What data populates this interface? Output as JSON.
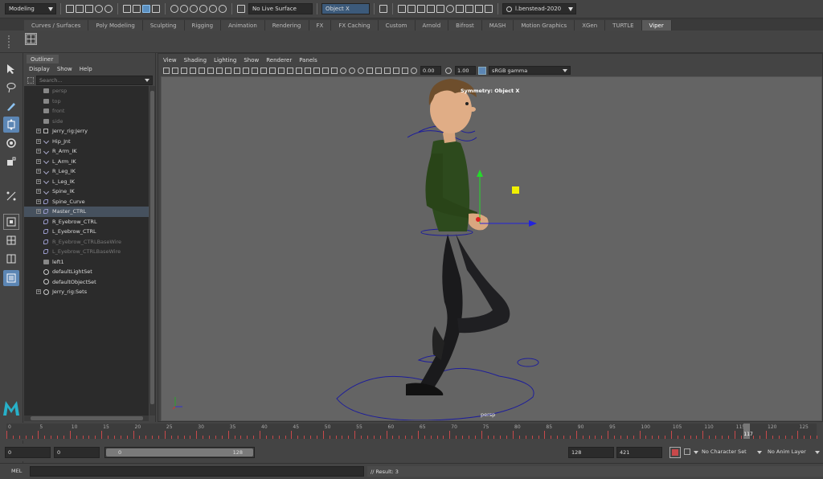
{
  "status_line": {
    "menu_set": "Modeling",
    "live_surface": "No Live Surface",
    "symmetry": "Object X",
    "user": "l.benstead-2020"
  },
  "shelf": {
    "tabs": [
      "Curves / Surfaces",
      "Poly Modeling",
      "Sculpting",
      "Rigging",
      "Animation",
      "Rendering",
      "FX",
      "FX Caching",
      "Custom",
      "Arnold",
      "Bifrost",
      "MASH",
      "Motion Graphics",
      "XGen",
      "TURTLE",
      "Viper"
    ],
    "active_tab": "Viper"
  },
  "outliner": {
    "tab": "Outliner",
    "menu": [
      "Display",
      "Show",
      "Help"
    ],
    "search_placeholder": "Search...",
    "items": [
      {
        "label": "persp",
        "icon": "camera-icon",
        "dim": true,
        "expandable": false
      },
      {
        "label": "top",
        "icon": "camera-icon",
        "dim": true,
        "expandable": false
      },
      {
        "label": "front",
        "icon": "camera-icon",
        "dim": true,
        "expandable": false
      },
      {
        "label": "side",
        "icon": "camera-icon",
        "dim": true,
        "expandable": false
      },
      {
        "label": "Jerry_rig:Jerry",
        "icon": "transform-icon",
        "dim": false,
        "expandable": true
      },
      {
        "label": "Hip_Jnt",
        "icon": "joint-icon",
        "dim": false,
        "expandable": true
      },
      {
        "label": "R_Arm_IK",
        "icon": "ik-handle-icon",
        "dim": false,
        "expandable": true
      },
      {
        "label": "L_Arm_IK",
        "icon": "ik-handle-icon",
        "dim": false,
        "expandable": true
      },
      {
        "label": "R_Leg_IK",
        "icon": "ik-handle-icon",
        "dim": false,
        "expandable": true
      },
      {
        "label": "L_Leg_IK",
        "icon": "ik-handle-icon",
        "dim": false,
        "expandable": true
      },
      {
        "label": "Spine_IK",
        "icon": "ik-handle-icon",
        "dim": false,
        "expandable": true
      },
      {
        "label": "Spine_Curve",
        "icon": "curve-icon",
        "dim": false,
        "expandable": true
      },
      {
        "label": "Master_CTRL",
        "icon": "curve-icon",
        "dim": false,
        "expandable": true,
        "selected": true
      },
      {
        "label": "R_Eyebrow_CTRL",
        "icon": "curve-icon",
        "dim": false,
        "expandable": false
      },
      {
        "label": "L_Eyebrow_CTRL",
        "icon": "curve-icon",
        "dim": false,
        "expandable": false
      },
      {
        "label": "R_Eyebrow_CTRLBaseWire",
        "icon": "curve-icon",
        "dim": true,
        "expandable": false
      },
      {
        "label": "L_Eyebrow_CTRLBaseWire",
        "icon": "curve-icon",
        "dim": true,
        "expandable": false
      },
      {
        "label": "left1",
        "icon": "camera-icon",
        "dim": false,
        "expandable": false
      },
      {
        "label": "defaultLightSet",
        "icon": "set-icon",
        "dim": false,
        "expandable": false
      },
      {
        "label": "defaultObjectSet",
        "icon": "set-icon",
        "dim": false,
        "expandable": false
      },
      {
        "label": "Jerry_rig:Sets",
        "icon": "set-icon",
        "dim": false,
        "expandable": true
      }
    ]
  },
  "viewport": {
    "menu": [
      "View",
      "Shading",
      "Lighting",
      "Show",
      "Renderer",
      "Panels"
    ],
    "exposure": "0.00",
    "gamma": "1.00",
    "color_space": "sRGB gamma",
    "symmetry_label": "Symmetry: Object X",
    "camera_label": "persp"
  },
  "time_slider": {
    "ticks": [
      "0",
      "5",
      "10",
      "15",
      "20",
      "25",
      "30",
      "35",
      "40",
      "45",
      "50",
      "55",
      "60",
      "65",
      "70",
      "75",
      "80",
      "85",
      "90",
      "95",
      "100",
      "105",
      "110",
      "115",
      "120",
      "125"
    ],
    "range": [
      0,
      128
    ],
    "current_frame": "117"
  },
  "range_slider": {
    "start": "0",
    "playback_start": "0",
    "range_start_label": "0",
    "range_end_label": "128",
    "playback_end": "128",
    "end": "421",
    "character_set": "No Character Set",
    "anim_layer": "No Anim Layer"
  },
  "command_line": {
    "label": "MEL",
    "result": "// Result: 3"
  },
  "colors": {
    "selection": "#46515e",
    "accent": "#5c86b4",
    "timeline_ticks": "#c8494b"
  }
}
